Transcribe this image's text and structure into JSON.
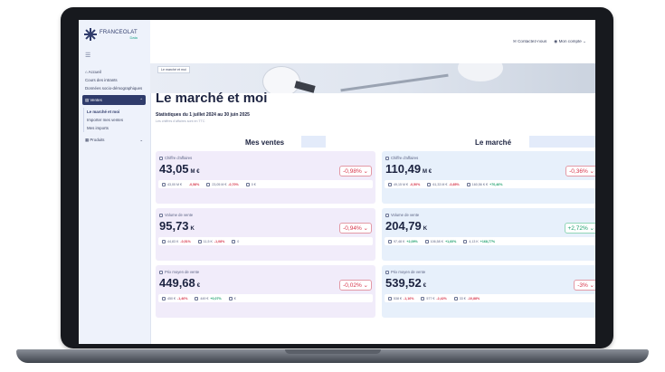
{
  "brand": {
    "name": "FRANCEOLAT",
    "sub": "Data"
  },
  "topbar": {
    "contact": "Contactez-nous",
    "account": "Mon compte"
  },
  "sidebar": {
    "items": [
      "Accueil",
      "Cours des intrants",
      "Données socio-démographiques"
    ],
    "group_ventes": "Ventes",
    "sub_items": [
      "Le marché et moi",
      "Importer mes ventes",
      "Mes imports"
    ],
    "group_produits": "Produits"
  },
  "hero_badge": "Le marché et moi",
  "page": {
    "title": "Le marché et moi",
    "subtitle": "Statistiques du 1 juillet 2024 au 30 juin 2025",
    "note": "Les chiffres d'affaires sont en TTC"
  },
  "sections": {
    "mine": "Mes ventes",
    "market": "Le marché"
  },
  "cards_left": [
    {
      "label": "Chiffre d'affaires",
      "value": "43,05",
      "unit": "M €",
      "delta": "-0,98%",
      "delta_type": "neg",
      "stats": [
        {
          "v": "43,00 M €",
          "p": "-0,58%",
          "t": "neg"
        },
        {
          "v": "23,05 M €",
          "p": "-0,70%",
          "t": "neg"
        },
        {
          "v": "0 €",
          "p": "",
          "t": ""
        }
      ]
    },
    {
      "label": "Volume de vente",
      "value": "95,73",
      "unit": "K",
      "delta": "-0,94%",
      "delta_type": "neg",
      "stats": [
        {
          "v": "44,83 K",
          "p": "-0,51%",
          "t": "neg"
        },
        {
          "v": "11,5 K",
          "p": "-1,08%",
          "t": "neg"
        },
        {
          "v": "0",
          "p": "",
          "t": ""
        }
      ]
    },
    {
      "label": "Prix moyen de vente",
      "value": "449,68",
      "unit": "€",
      "delta": "-0,02%",
      "delta_type": "neg",
      "stats": [
        {
          "v": "450 €",
          "p": "-1,46%",
          "t": "neg"
        },
        {
          "v": "449 €",
          "p": "+0,07%",
          "t": "pos"
        },
        {
          "v": "€",
          "p": "",
          "t": ""
        }
      ]
    }
  ],
  "cards_right": [
    {
      "label": "Chiffre d'affaires",
      "value": "110,49",
      "unit": "M €",
      "delta": "-0,36%",
      "delta_type": "neg",
      "stats": [
        {
          "v": "49,15 M €",
          "p": "-0,50%",
          "t": "neg"
        },
        {
          "v": "61,33 M €",
          "p": "-0,85%",
          "t": "neg"
        },
        {
          "v": "160,56 K €",
          "p": "+70,46%",
          "t": "pos"
        }
      ]
    },
    {
      "label": "Volume de vente",
      "value": "204,79",
      "unit": "K",
      "delta": "+2,72%",
      "delta_type": "pos",
      "stats": [
        {
          "v": "97,48 K",
          "p": "+2,09%",
          "t": "pos"
        },
        {
          "v": "106,58 K",
          "p": "+1,60%",
          "t": "pos"
        },
        {
          "v": "4,13 K",
          "p": "+168,77%",
          "t": "pos"
        }
      ]
    },
    {
      "label": "Prix moyen de vente",
      "value": "539,52",
      "unit": "€",
      "delta": "-3%",
      "delta_type": "neg",
      "stats": [
        {
          "v": "538 €",
          "p": "-1,16%",
          "t": "neg"
        },
        {
          "v": "577 €",
          "p": "-2,42%",
          "t": "neg"
        },
        {
          "v": "33 €",
          "p": "-10,88%",
          "t": "neg"
        }
      ]
    }
  ]
}
